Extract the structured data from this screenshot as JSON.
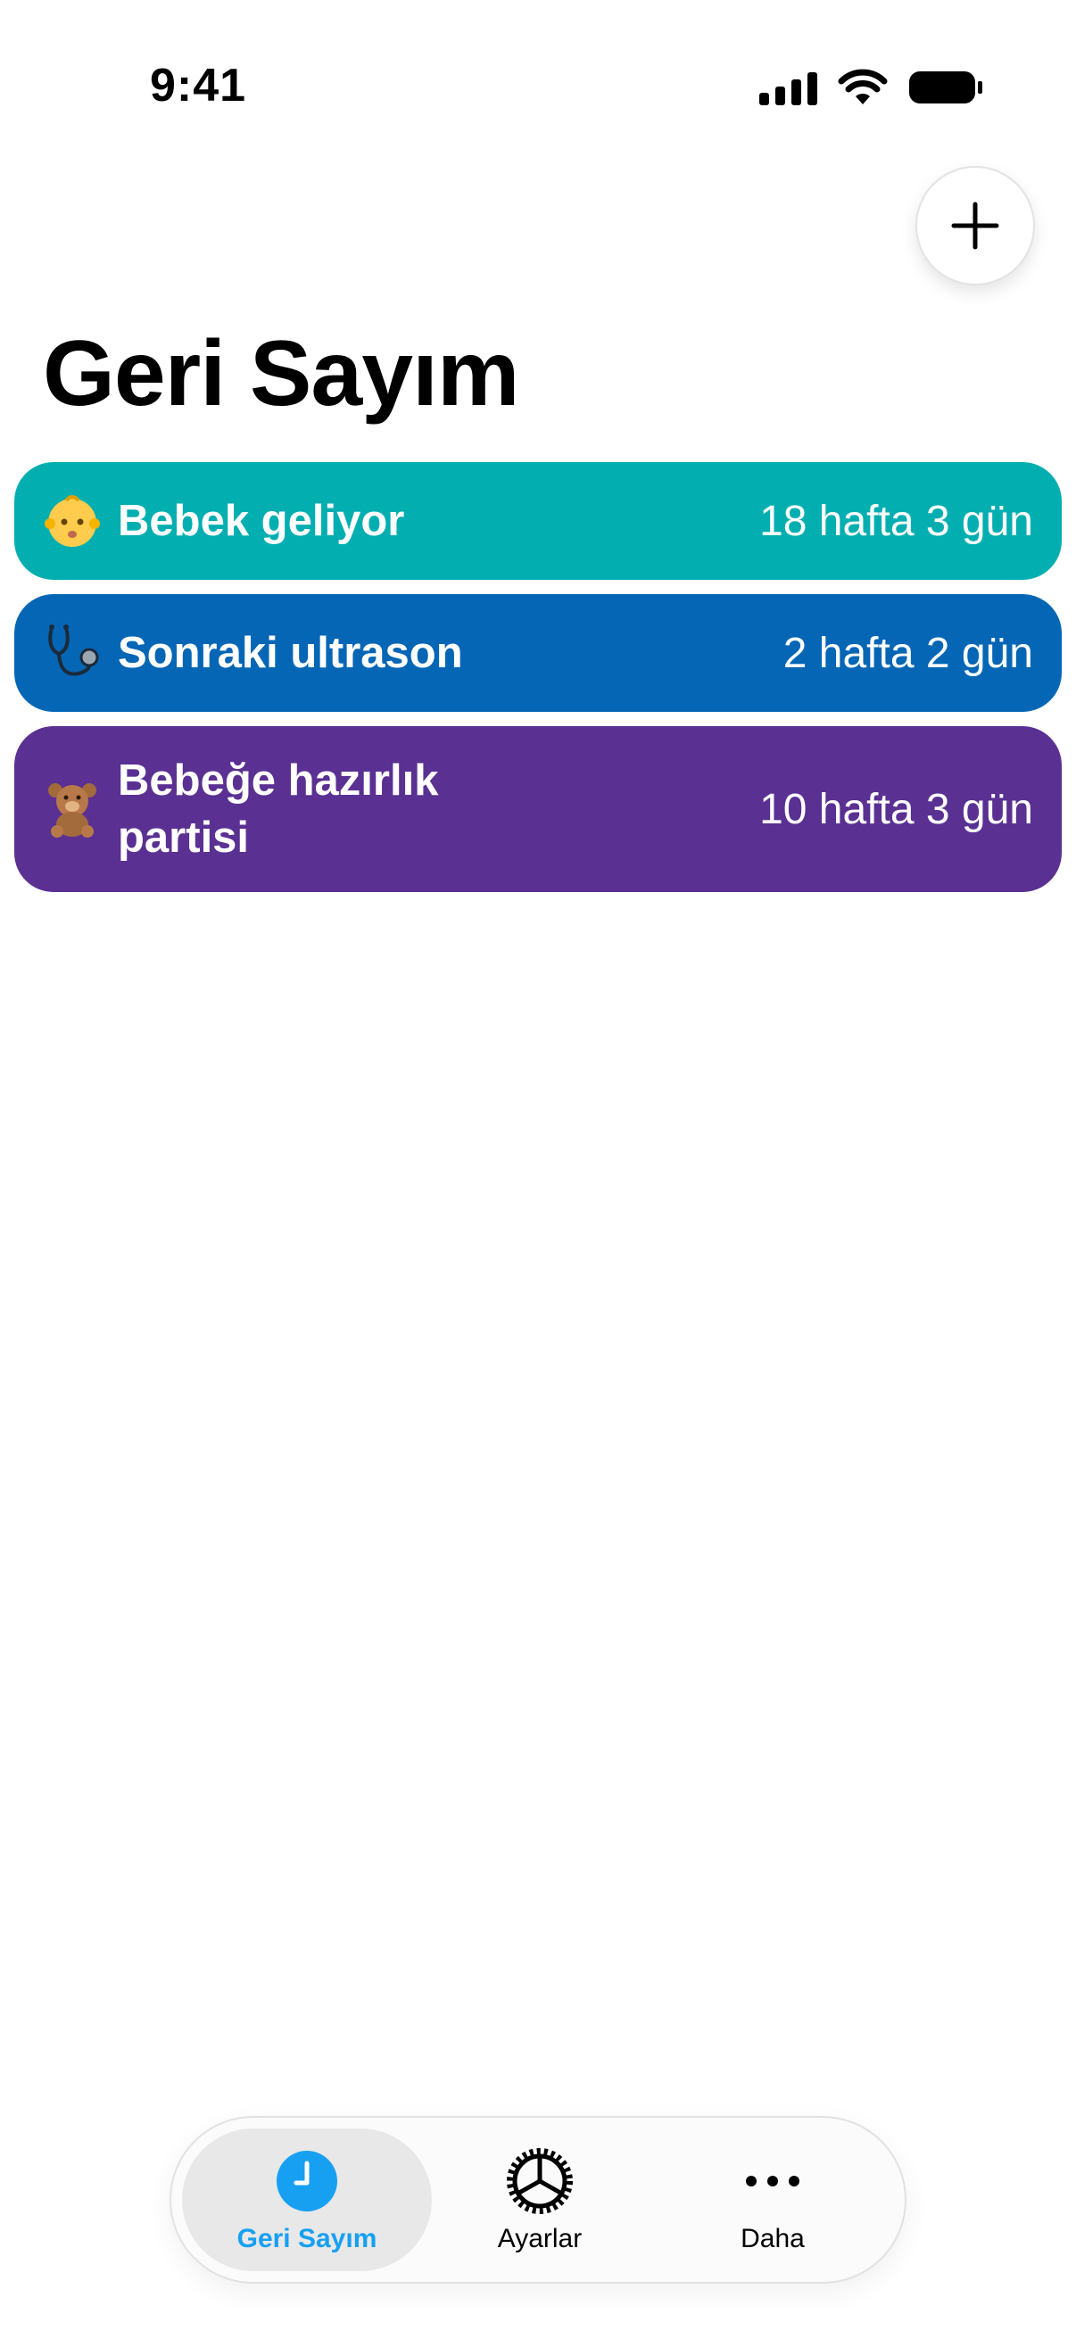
{
  "status_bar": {
    "time": "9:41"
  },
  "header": {
    "title": "Geri Sayım",
    "add_icon": "plus-icon"
  },
  "countdowns": [
    {
      "emoji": "👶",
      "name": "Bebek geliyor",
      "remaining": "18 hafta 3 gün",
      "color": "#03aeb0"
    },
    {
      "emoji": "🩺",
      "name": "Sonraki ultrason",
      "remaining": "2 hafta 2 gün",
      "color": "#0566b5"
    },
    {
      "emoji": "🧸",
      "name": "Bebeğe hazırlık partisi",
      "remaining": "10 hafta 3 gün",
      "color": "#5a3092"
    }
  ],
  "tab_bar": {
    "tabs": [
      {
        "label": "Geri Sayım",
        "icon": "clock-icon",
        "active": true
      },
      {
        "label": "Ayarlar",
        "icon": "gear-icon",
        "active": false
      },
      {
        "label": "Daha",
        "icon": "more-icon",
        "active": false
      }
    ],
    "accent_color": "#17a0f2"
  }
}
